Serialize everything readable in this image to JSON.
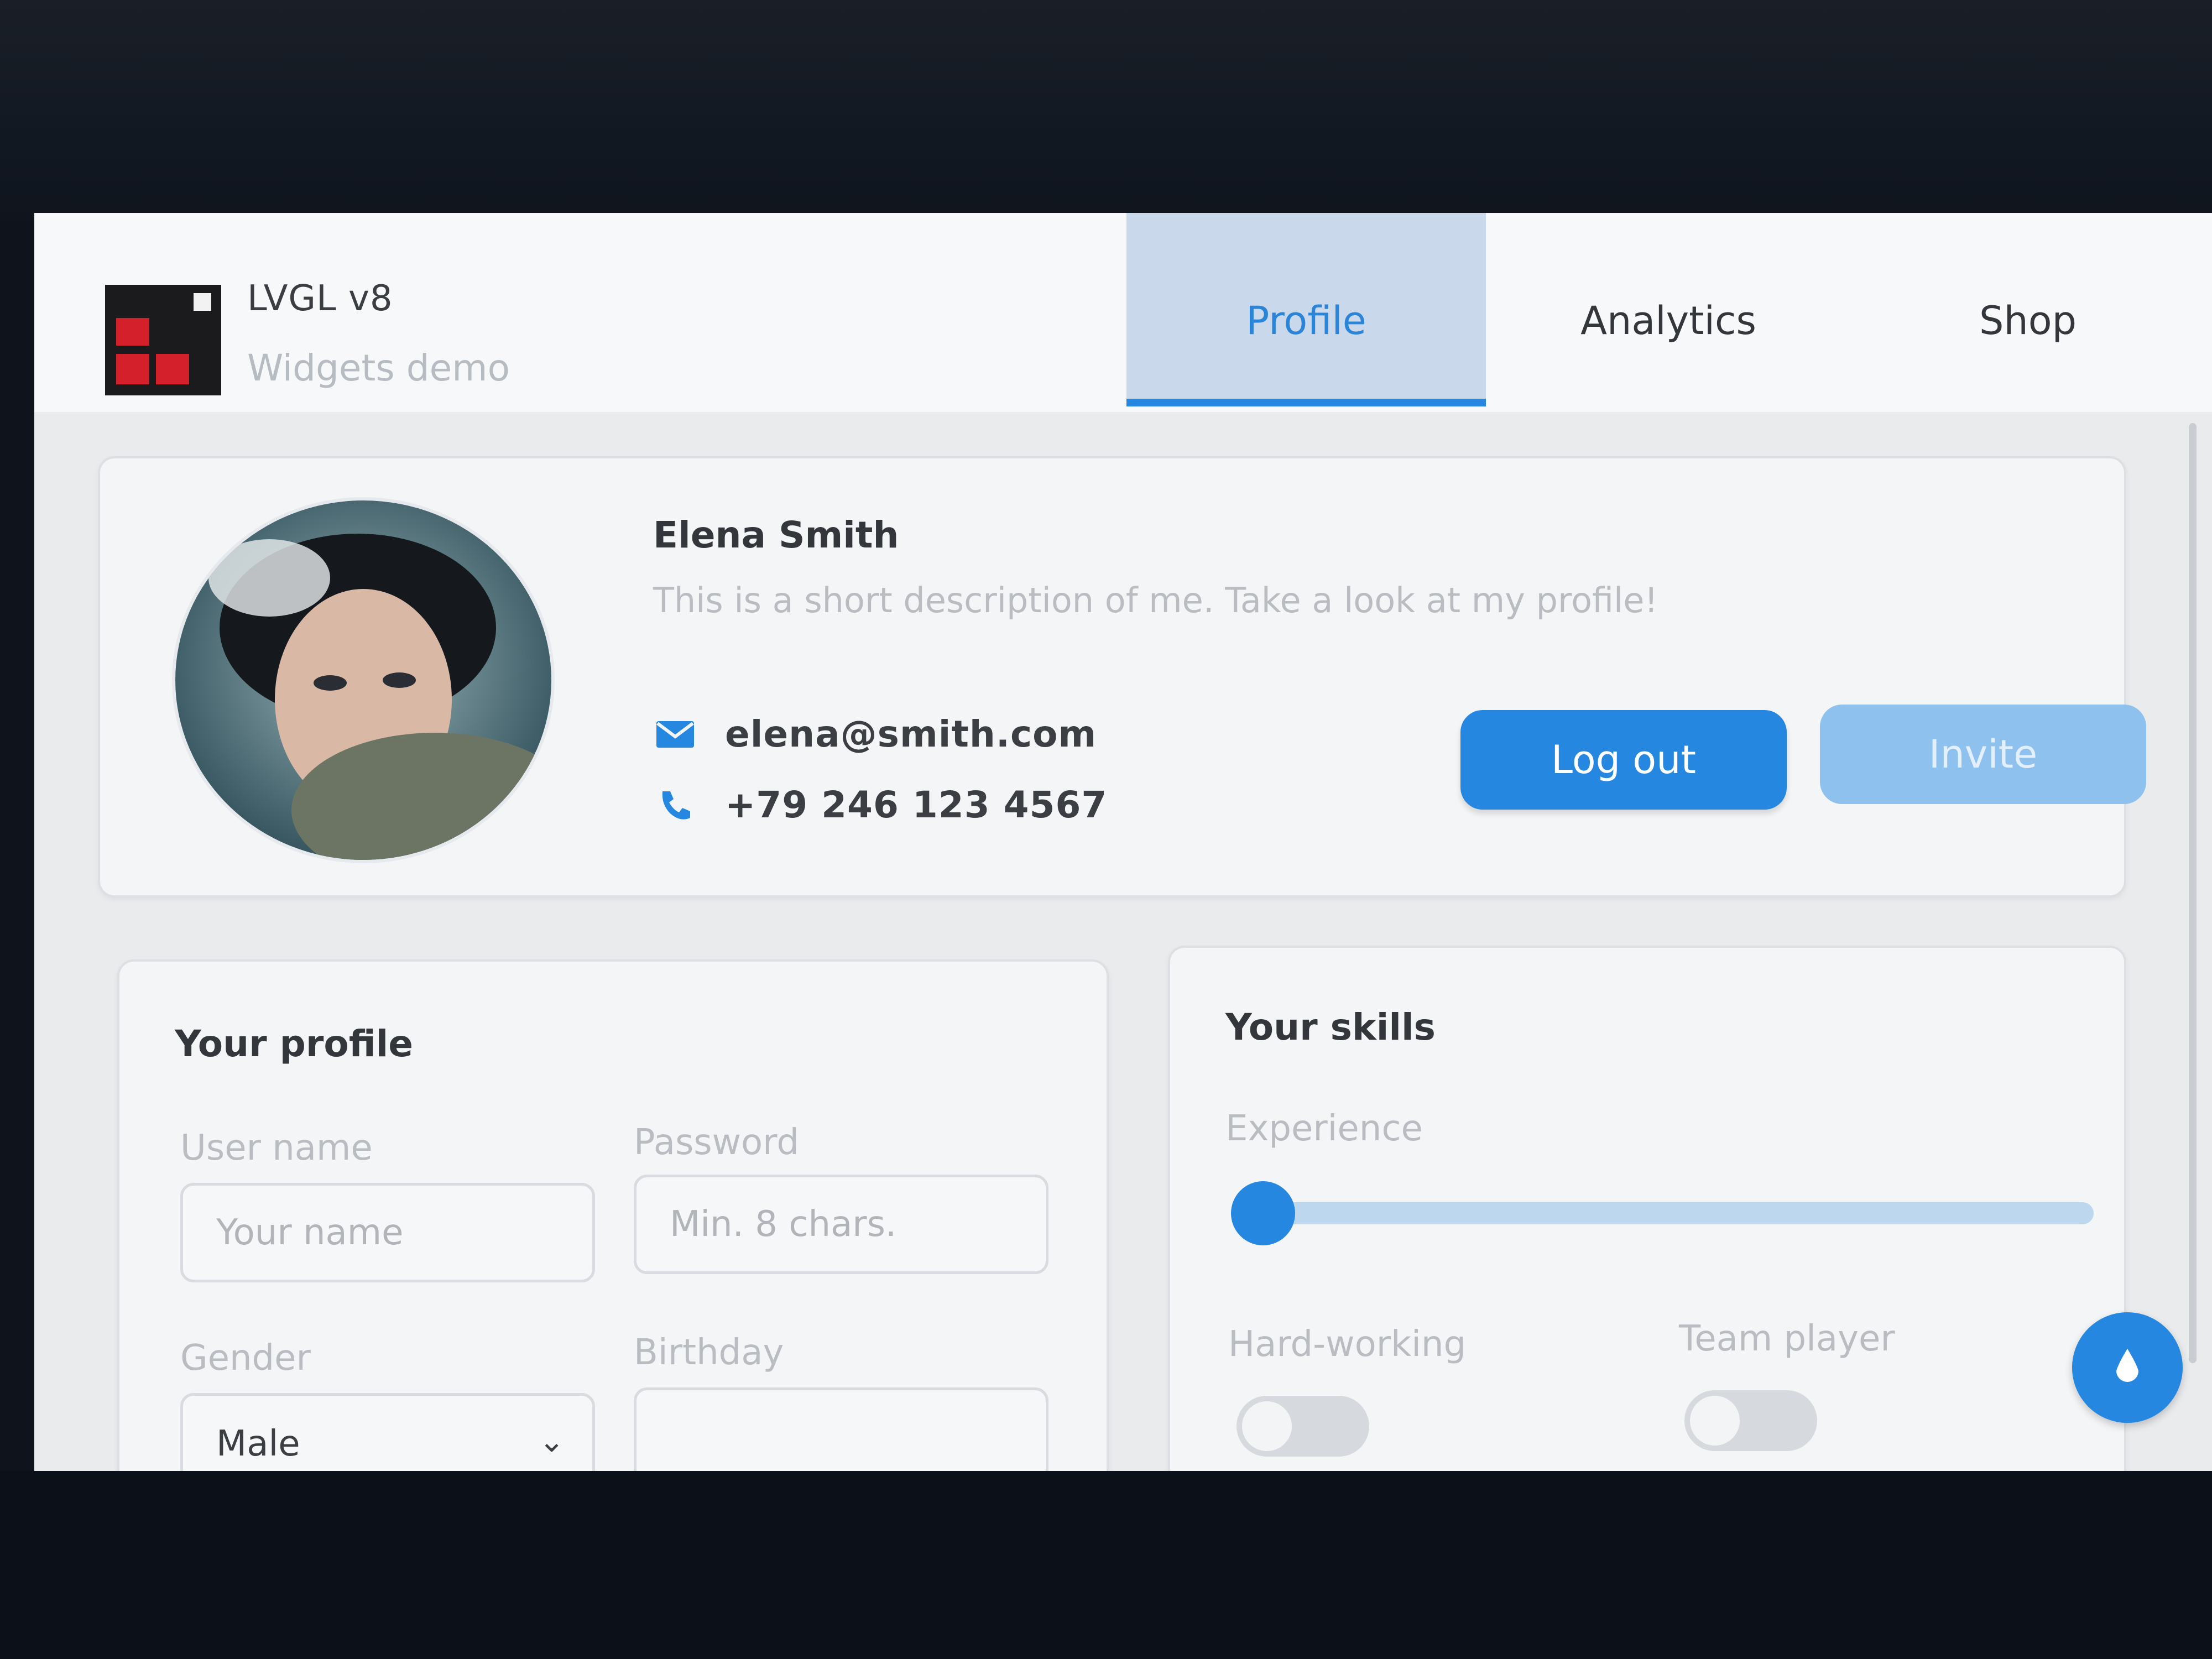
{
  "app": {
    "title": "LVGL v8",
    "subtitle": "Widgets demo"
  },
  "tabs": [
    {
      "label": "Profile",
      "active": true
    },
    {
      "label": "Analytics",
      "active": false
    },
    {
      "label": "Shop",
      "active": false
    }
  ],
  "profile": {
    "name": "Elena Smith",
    "description": "This is a short description of me. Take a look at my profile!",
    "email": "elena@smith.com",
    "phone": "+79 246 123 4567",
    "logout_label": "Log out",
    "invite_label": "Invite"
  },
  "your_profile": {
    "title": "Your profile",
    "username_label": "User name",
    "username_placeholder": "Your name",
    "password_label": "Password",
    "password_placeholder": "Min. 8 chars.",
    "gender_label": "Gender",
    "gender_value": "Male",
    "birthday_label": "Birthday"
  },
  "skills": {
    "title": "Your skills",
    "experience_label": "Experience",
    "experience_value": 0,
    "hardworking_label": "Hard-working",
    "teamplayer_label": "Team player"
  },
  "colors": {
    "accent": "#2587e0",
    "tab_active_bg": "#c9d8ea",
    "invite_bg": "#8fc1ee",
    "logo_red": "#d4202a"
  },
  "icons": {
    "email": "envelope-icon",
    "phone": "phone-icon",
    "fab": "droplet-icon",
    "dropdown": "chevron-down-icon"
  }
}
